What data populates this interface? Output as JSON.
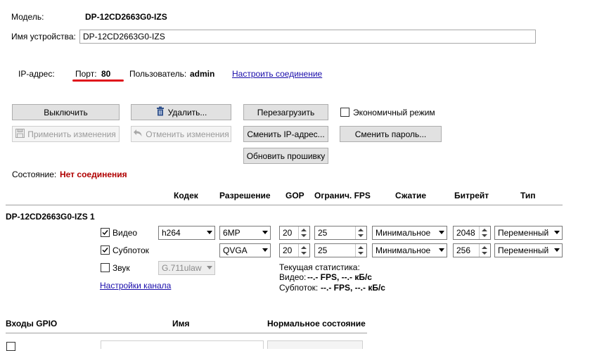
{
  "header": {
    "model_label": "Модель:",
    "model_value": "DP-12CD2663G0-IZS",
    "device_name_label": "Имя устройства:",
    "device_name_value": "DP-12CD2663G0-IZS",
    "ip_label": "IP-адрес:",
    "port_label": "Порт:",
    "port_value": "80",
    "user_label": "Пользователь:",
    "user_value": "admin",
    "setup_link": "Настроить соединение"
  },
  "actions": {
    "turn_off": "Выключить",
    "delete": "Удалить...",
    "reboot": "Перезагрузить",
    "eco_mode": "Экономичный режим",
    "apply": "Применить изменения",
    "cancel": "Отменить изменения",
    "change_ip": "Сменить IP-адрес...",
    "change_password": "Сменить пароль...",
    "update_firmware": "Обновить прошивку"
  },
  "status": {
    "label": "Состояние:",
    "value": "Нет соединения",
    "color": "#b00000"
  },
  "streams": {
    "headers": [
      "Кодек",
      "Разрешение",
      "GOP",
      "Огранич. FPS",
      "Сжатие",
      "Битрейт",
      "Тип"
    ],
    "channel_title": "DP-12CD2663G0-IZS 1",
    "video": {
      "label": "Видео",
      "checked": true,
      "codec": "h264",
      "resolution": "6MP",
      "gop": "20",
      "fps": "25",
      "compression": "Минимальное",
      "bitrate": "2048",
      "type": "Переменный"
    },
    "substream": {
      "label": "Субпоток",
      "checked": true,
      "resolution": "QVGA",
      "gop": "20",
      "fps": "25",
      "compression": "Минимальное",
      "bitrate": "256",
      "type": "Переменный"
    },
    "audio": {
      "label": "Звук",
      "checked": false,
      "codec": "G.711ulaw"
    },
    "channel_settings_link": "Настройки канала",
    "stats": {
      "title": "Текущая статистика:",
      "video_prefix": "Видео:",
      "video_value": "--.- FPS, --.- кБ/с",
      "sub_prefix": "Субпоток:",
      "sub_value": "--.- FPS, --.- кБ/с"
    }
  },
  "gpio": {
    "headers": [
      "Входы GPIO",
      "Имя",
      "Нормальное состояние"
    ]
  }
}
